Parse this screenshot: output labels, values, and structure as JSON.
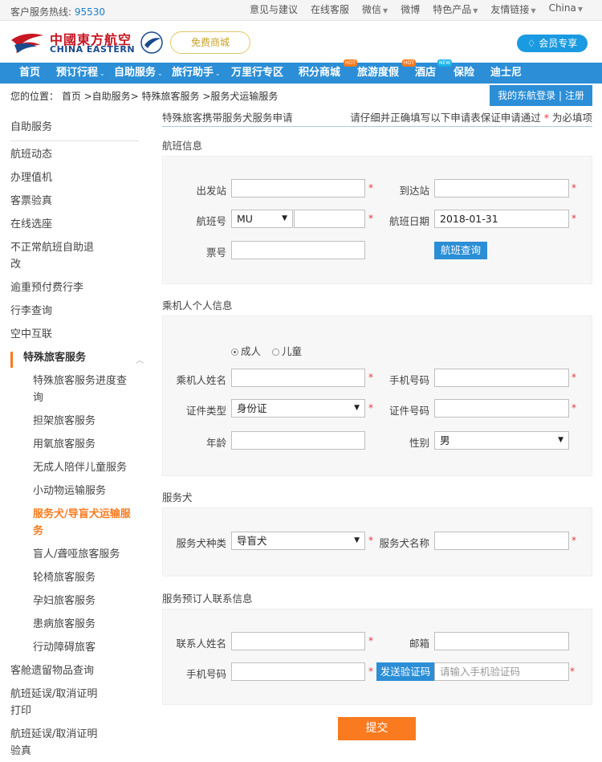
{
  "topbar": {
    "hotline_label": "客户服务热线:",
    "hotline_number": "95530",
    "links": [
      "意见与建议",
      "在线客服",
      "微信",
      "微博",
      "特色产品",
      "友情链接",
      "China"
    ]
  },
  "header": {
    "logo_cn": "中國東方航空",
    "logo_en": "CHINA EASTERN",
    "free_badge": "免费商城",
    "member_button": "会员专享",
    "member_icon": "diamond-icon"
  },
  "nav": [
    "首页",
    "预订行程",
    "自助服务",
    "旅行助手",
    "万里行专区",
    "积分商城",
    "旅游度假",
    "酒店",
    "保险",
    "迪士尼"
  ],
  "nav_tags": {
    "hot": "HOT",
    "new": "NEW"
  },
  "breadcrumb": "您的位置： 首页 >自助服务> 特殊旅客服务 >服务犬运输服务",
  "login_button": "我的东航登录 | 注册",
  "sidebar": {
    "header": "自助服务",
    "items": [
      "航班动态",
      "办理值机",
      "客票验真",
      "在线选座",
      "不正常航班自助退",
      "改",
      "逾重预付费行李",
      "行李查询",
      "空中互联"
    ],
    "section": "特殊旅客服务",
    "sub_items": [
      "特殊旅客服务进度查",
      "询",
      "担架旅客服务",
      "用氧旅客服务",
      "无成人陪伴儿童服务",
      "小动物运输服务",
      "服务犬/导盲犬运输服",
      "务",
      "盲人/聋哑旅客服务",
      "轮椅旅客服务",
      "孕妇旅客服务",
      "患病旅客服务",
      "行动障碍旅客"
    ],
    "tail_items": [
      "客舱遗留物品查询",
      "航班延误/取消证明",
      "打印",
      "航班延误/取消证明",
      "验真"
    ]
  },
  "form": {
    "title": "特殊旅客携带服务犬服务申请",
    "hint": "请仔细并正确填写以下申请表保证申请通过",
    "hint_star": "*",
    "hint_tail": "为必填项",
    "star": "*",
    "flight_section": "航班信息",
    "departure_label": "出发站",
    "arrival_label": "到达站",
    "flight_no_label": "航班号",
    "flight_prefix": "MU",
    "flight_date_label": "航班日期",
    "flight_date": "2018-01-31",
    "ticket_label": "票号",
    "query_button": "航班查询",
    "passenger_section": "乘机人个人信息",
    "adult": "成人",
    "child": "儿童",
    "name_label": "乘机人姓名",
    "phone_label": "手机号码",
    "id_type_label": "证件类型",
    "id_type": "身份证",
    "id_no_label": "证件号码",
    "age_label": "年龄",
    "gender_label": "性别",
    "gender": "男",
    "dog_section": "服务犬",
    "dog_type_label": "服务犬种类",
    "dog_type": "导盲犬",
    "dog_name_label": "服务犬名称",
    "contact_section": "服务预订人联系信息",
    "contact_name_label": "联系人姓名",
    "email_label": "邮箱",
    "contact_phone_label": "手机号码",
    "send_code_button": "发送验证码",
    "code_placeholder": "请输入手机验证码",
    "submit": "提交"
  },
  "colors": {
    "brand_blue": "#2b8ed6",
    "accent_orange": "#f97a1f",
    "required_red": "#e4393c"
  }
}
